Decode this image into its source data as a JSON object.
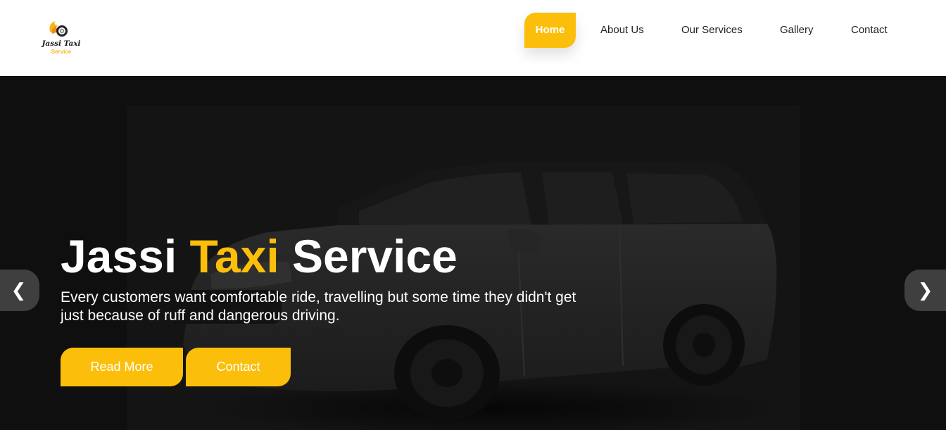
{
  "logo": {
    "title": "Jassi Taxi",
    "subtitle": "Service",
    "icon": "taxi-wheel-flame-icon"
  },
  "nav": {
    "items": [
      {
        "label": "Home",
        "active": true
      },
      {
        "label": "About Us",
        "active": false
      },
      {
        "label": "Our Services",
        "active": false
      },
      {
        "label": "Gallery",
        "active": false
      },
      {
        "label": "Contact",
        "active": false
      }
    ]
  },
  "hero": {
    "title_part1": "Jassi ",
    "title_accent": "Taxi",
    "title_part2": " Service",
    "description": "Every customers want comfortable ride, travelling but some time they didn't get just because of ruff and dangerous driving.",
    "buttons": {
      "read_more": "Read More",
      "contact": "Contact"
    },
    "background": "white-suv-dark-overlay",
    "prev_icon": "chevron-left-icon",
    "next_icon": "chevron-right-icon"
  },
  "colors": {
    "accent": "#fbbf0b",
    "hero_bg": "#0f0f0f",
    "text_dark": "#222222"
  }
}
